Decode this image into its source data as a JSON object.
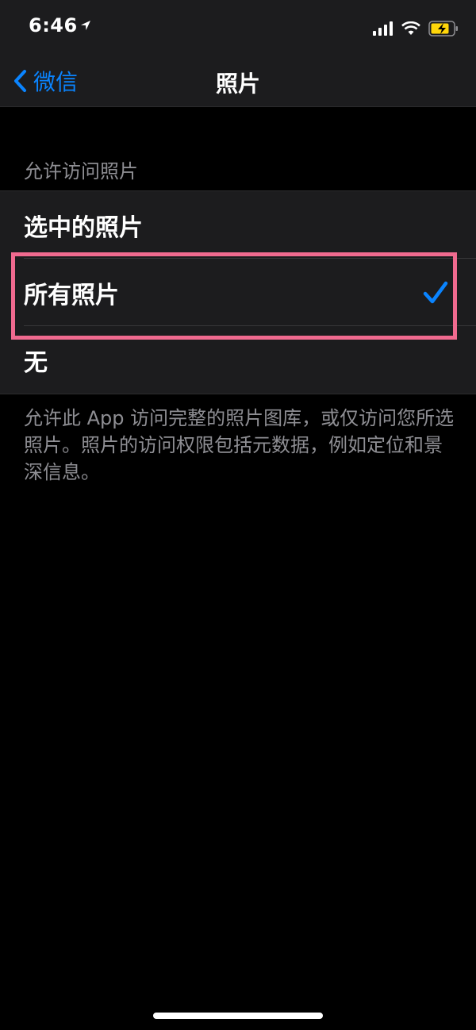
{
  "status_bar": {
    "time": "6:46",
    "icons": [
      "location-icon",
      "cellular-icon",
      "wifi-icon",
      "battery-charging-icon"
    ]
  },
  "nav": {
    "back_label": "微信",
    "title": "照片"
  },
  "section": {
    "header": "允许访问照片",
    "options": [
      {
        "label": "选中的照片",
        "selected": false
      },
      {
        "label": "所有照片",
        "selected": true
      },
      {
        "label": "无",
        "selected": false
      }
    ],
    "footer": "允许此 App 访问完整的照片图库，或仅访问您所选照片。照片的访问权限包括元数据，例如定位和景深信息。"
  },
  "colors": {
    "accent": "#0a84ff",
    "highlight": "#f06a8f",
    "background": "#000000",
    "cell": "#1c1c1e",
    "secondary_text": "#8e8e93"
  }
}
